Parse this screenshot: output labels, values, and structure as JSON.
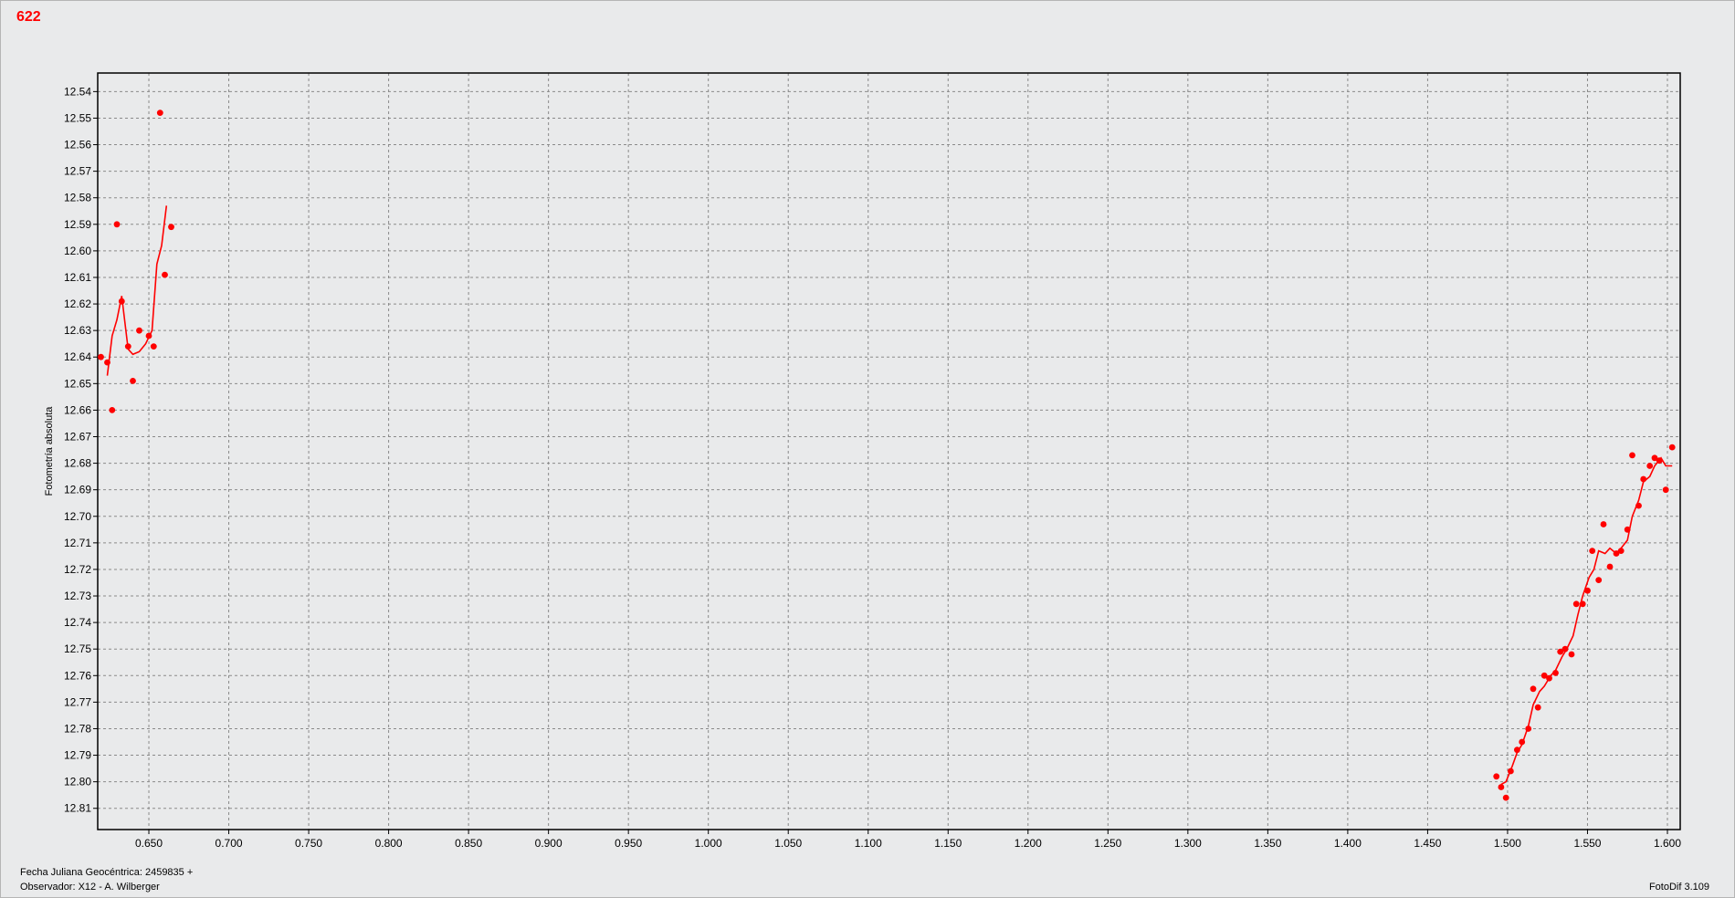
{
  "title": "622",
  "footer": {
    "line1": "Fecha Juliana Geocéntrica: 2459835 +",
    "line2": "Observador: X12 - A. Wilberger",
    "version": "FotoDif 3.109"
  },
  "colors": {
    "series": "#ff0000",
    "grid": "#8a8a8a",
    "plot_background": "#e9eaeb"
  },
  "chart_data": {
    "type": "scatter",
    "title": "622",
    "xlabel": "",
    "ylabel": "Fotometría absoluta",
    "x_range": [
      0.618,
      1.608
    ],
    "y_range": [
      12.533,
      12.818
    ],
    "y_inverted": true,
    "grid": true,
    "x_ticks": [
      "0.650",
      "0.700",
      "0.750",
      "0.800",
      "0.850",
      "0.900",
      "0.950",
      "1.000",
      "1.050",
      "1.100",
      "1.150",
      "1.200",
      "1.250",
      "1.300",
      "1.350",
      "1.400",
      "1.450",
      "1.500",
      "1.550",
      "1.600"
    ],
    "y_ticks": [
      "12.54",
      "12.55",
      "12.56",
      "12.57",
      "12.58",
      "12.59",
      "12.60",
      "12.61",
      "12.62",
      "12.63",
      "12.64",
      "12.65",
      "12.66",
      "12.67",
      "12.68",
      "12.69",
      "12.70",
      "12.71",
      "12.72",
      "12.73",
      "12.74",
      "12.75",
      "12.76",
      "12.77",
      "12.78",
      "12.79",
      "12.80",
      "12.81"
    ],
    "points": [
      [
        0.62,
        12.64
      ],
      [
        0.624,
        12.642
      ],
      [
        0.627,
        12.66
      ],
      [
        0.63,
        12.59
      ],
      [
        0.633,
        12.619
      ],
      [
        0.637,
        12.636
      ],
      [
        0.64,
        12.649
      ],
      [
        0.644,
        12.63
      ],
      [
        0.65,
        12.632
      ],
      [
        0.653,
        12.636
      ],
      [
        0.657,
        12.548
      ],
      [
        0.66,
        12.609
      ],
      [
        0.664,
        12.591
      ],
      [
        1.493,
        12.798
      ],
      [
        1.496,
        12.802
      ],
      [
        1.499,
        12.806
      ],
      [
        1.502,
        12.796
      ],
      [
        1.506,
        12.788
      ],
      [
        1.509,
        12.785
      ],
      [
        1.513,
        12.78
      ],
      [
        1.516,
        12.765
      ],
      [
        1.519,
        12.772
      ],
      [
        1.523,
        12.76
      ],
      [
        1.526,
        12.761
      ],
      [
        1.53,
        12.759
      ],
      [
        1.533,
        12.751
      ],
      [
        1.536,
        12.75
      ],
      [
        1.54,
        12.752
      ],
      [
        1.543,
        12.733
      ],
      [
        1.547,
        12.733
      ],
      [
        1.55,
        12.728
      ],
      [
        1.553,
        12.713
      ],
      [
        1.557,
        12.724
      ],
      [
        1.56,
        12.703
      ],
      [
        1.564,
        12.719
      ],
      [
        1.568,
        12.714
      ],
      [
        1.571,
        12.713
      ],
      [
        1.575,
        12.705
      ],
      [
        1.578,
        12.677
      ],
      [
        1.582,
        12.696
      ],
      [
        1.585,
        12.686
      ],
      [
        1.589,
        12.681
      ],
      [
        1.592,
        12.678
      ],
      [
        1.595,
        12.679
      ],
      [
        1.599,
        12.69
      ],
      [
        1.603,
        12.674
      ]
    ],
    "fit_segments": [
      [
        [
          0.624,
          12.647
        ],
        [
          0.627,
          12.632
        ],
        [
          0.63,
          12.626
        ],
        [
          0.633,
          12.617
        ],
        [
          0.637,
          12.637
        ],
        [
          0.64,
          12.639
        ],
        [
          0.644,
          12.638
        ],
        [
          0.648,
          12.635
        ],
        [
          0.652,
          12.63
        ],
        [
          0.655,
          12.605
        ],
        [
          0.658,
          12.598
        ],
        [
          0.661,
          12.583
        ]
      ],
      [
        [
          1.496,
          12.801
        ],
        [
          1.499,
          12.8
        ],
        [
          1.503,
          12.794
        ],
        [
          1.506,
          12.789
        ],
        [
          1.509,
          12.786
        ],
        [
          1.513,
          12.779
        ],
        [
          1.516,
          12.771
        ],
        [
          1.52,
          12.766
        ],
        [
          1.523,
          12.764
        ],
        [
          1.527,
          12.76
        ],
        [
          1.53,
          12.758
        ],
        [
          1.534,
          12.753
        ],
        [
          1.537,
          12.75
        ],
        [
          1.541,
          12.745
        ],
        [
          1.544,
          12.737
        ],
        [
          1.547,
          12.73
        ],
        [
          1.551,
          12.723
        ],
        [
          1.554,
          12.72
        ],
        [
          1.557,
          12.713
        ],
        [
          1.561,
          12.714
        ],
        [
          1.564,
          12.712
        ],
        [
          1.568,
          12.714
        ],
        [
          1.571,
          12.712
        ],
        [
          1.575,
          12.709
        ],
        [
          1.578,
          12.7
        ],
        [
          1.582,
          12.694
        ],
        [
          1.585,
          12.687
        ],
        [
          1.589,
          12.685
        ],
        [
          1.592,
          12.681
        ],
        [
          1.596,
          12.678
        ],
        [
          1.599,
          12.681
        ],
        [
          1.603,
          12.681
        ]
      ]
    ]
  }
}
